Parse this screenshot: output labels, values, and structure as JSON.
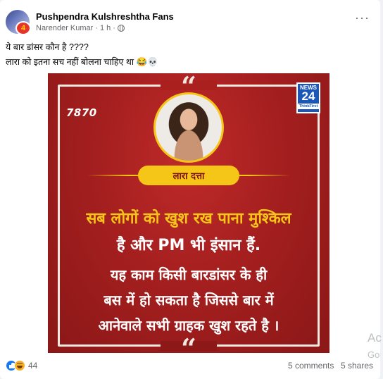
{
  "post": {
    "group_name": "Pushpendra Kulshreshtha Fans",
    "author": "Narender Kumar",
    "time": "1 h",
    "separator": "·",
    "more_label": "···",
    "text_line1": "ये बार डांसर कौन है ????",
    "text_line2": "लारा को इतना सच नहीं बोलना चाहिए था 😂💀"
  },
  "media": {
    "quote_mark": "“",
    "code": "7870",
    "logo": {
      "line1": "NEWS",
      "line2": "24",
      "line3": "ThinkFirst"
    },
    "name_label": "लारा दत्ता",
    "line1": "सब लोगों को खुश रख पाना मुश्किल",
    "line2": "है और PM भी इंसान हैं.",
    "line3": "यह काम किसी बारडांसर के ही",
    "line4": "बस में हो सकता है जिससे बार में",
    "line5": "आनेवाले सभी ग्राहक खुश रहते है ।"
  },
  "overlay": {
    "line1": "Ac",
    "line2": "Go"
  },
  "footer": {
    "reaction_count": "44",
    "comments": "5 comments",
    "shares": "5 shares"
  },
  "colors": {
    "accent": "#1877f2",
    "banner_red": "#a51f1f",
    "highlight_yellow": "#f5c518"
  },
  "icons": [
    "globe-icon",
    "more-icon",
    "like-icon",
    "haha-icon"
  ]
}
